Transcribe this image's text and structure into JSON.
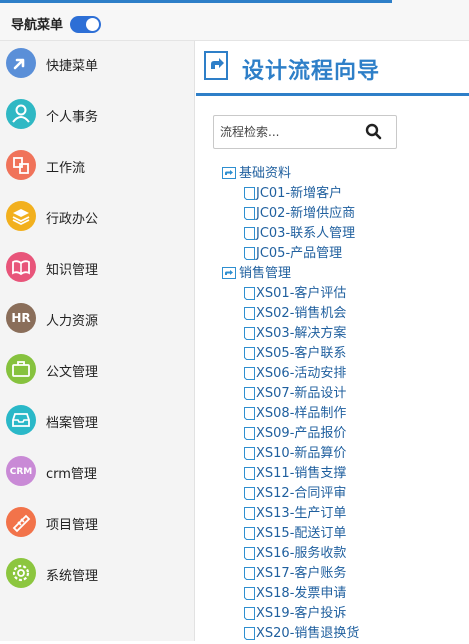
{
  "topbar": {
    "nav_label": "导航菜单"
  },
  "sidebar": {
    "items": [
      {
        "label": "快捷菜单",
        "icon": "arrow-icon",
        "color": "#5a8fd8",
        "glyph": ""
      },
      {
        "label": "个人事务",
        "icon": "person-icon",
        "color": "#2fb8c4",
        "glyph": ""
      },
      {
        "label": "工作流",
        "icon": "workflow-icon",
        "color": "#f0735a",
        "glyph": ""
      },
      {
        "label": "行政办公",
        "icon": "layers-icon",
        "color": "#f2b01e",
        "glyph": ""
      },
      {
        "label": "知识管理",
        "icon": "book-icon",
        "color": "#e8557a",
        "glyph": ""
      },
      {
        "label": "人力资源",
        "icon": "hr-icon",
        "color": "#8a6e5a",
        "glyph": "HR"
      },
      {
        "label": "公文管理",
        "icon": "briefcase-icon",
        "color": "#86c23e",
        "glyph": ""
      },
      {
        "label": "档案管理",
        "icon": "archive-icon",
        "color": "#2ab8c8",
        "glyph": ""
      },
      {
        "label": "crm管理",
        "icon": "crm-icon",
        "color": "#c98ad6",
        "glyph": "CRM"
      },
      {
        "label": "项目管理",
        "icon": "project-icon",
        "color": "#f2734a",
        "glyph": ""
      },
      {
        "label": "系统管理",
        "icon": "gear-icon",
        "color": "#8cc63f",
        "glyph": ""
      }
    ]
  },
  "main": {
    "title": "设计流程向导",
    "search_placeholder": "流程检索..."
  },
  "tree": {
    "groups": [
      {
        "label": "基础资料",
        "items": [
          "JC01-新增客户",
          "JC02-新增供应商",
          "JC03-联系人管理",
          "JC05-产品管理"
        ]
      },
      {
        "label": "销售管理",
        "items": [
          "XS01-客户评估",
          "XS02-销售机会",
          "XS03-解决方案",
          "XS05-客户联系",
          "XS06-活动安排",
          "XS07-新品设计",
          "XS08-样品制作",
          "XS09-产品报价",
          "XS10-新品算价",
          "XS11-销售支撑",
          "XS12-合同评审",
          "XS13-生产订单",
          "XS15-配送订单",
          "XS16-服务收款",
          "XS17-客户账务",
          "XS18-发票申请",
          "XS19-客户投诉",
          "XS20-销售退换货"
        ]
      }
    ]
  }
}
